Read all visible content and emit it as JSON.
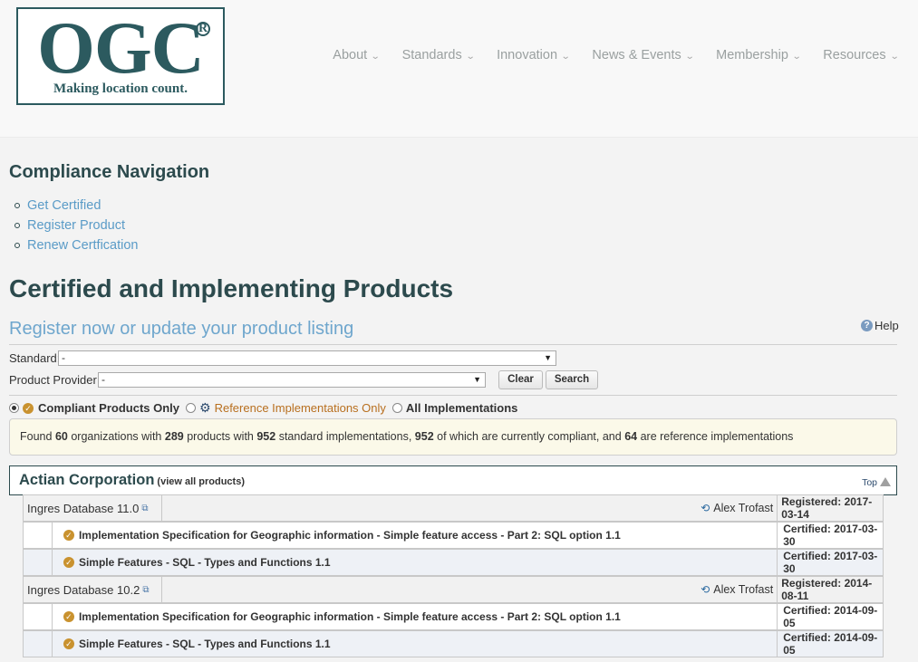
{
  "header": {
    "logo_text": "OGC",
    "logo_reg": "R",
    "logo_tagline": "Making location count.",
    "nav": [
      {
        "label": "About"
      },
      {
        "label": "Standards"
      },
      {
        "label": "Innovation"
      },
      {
        "label": "News & Events"
      },
      {
        "label": "Membership"
      },
      {
        "label": "Resources"
      }
    ]
  },
  "compliance": {
    "title": "Compliance Navigation",
    "links": [
      "Get Certified",
      "Register Product",
      "Renew Certfication"
    ]
  },
  "main": {
    "title": "Certified and Implementing Products",
    "register_link": "Register now or update your product listing",
    "help": "Help",
    "standard_label": "Standard:",
    "standard_value": "-",
    "provider_label": "Product Provider:",
    "provider_value": "-",
    "clear_label": "Clear",
    "search_label": "Search",
    "filters": {
      "compliant": "Compliant Products Only",
      "reference": "Reference Implementations Only",
      "all": "All Implementations"
    },
    "found": {
      "prefix": "Found",
      "orgs": "60",
      "t1": "organizations with",
      "products": "289",
      "t2": "products with",
      "impls": "952",
      "t3": "standard implementations,",
      "compliant": "952",
      "t4": "of which are currently compliant, and",
      "refs": "64",
      "t5": "are reference implementations"
    }
  },
  "organization": {
    "name": "Actian Corporation",
    "view_all": "(view all products)",
    "top_label": "Top",
    "products": [
      {
        "name": "Ingres Database 11.0",
        "user": "Alex Trofast",
        "registered": "Registered: 2017-03-14",
        "standards": [
          {
            "name": "Implementation Specification for Geographic information - Simple feature access - Part 2: SQL option 1.1",
            "certified": "Certified: 2017-03-30"
          },
          {
            "name": "Simple Features - SQL - Types and Functions 1.1",
            "certified": "Certified: 2017-03-30"
          }
        ]
      },
      {
        "name": "Ingres Database 10.2",
        "user": "Alex Trofast",
        "registered": "Registered: 2014-08-11",
        "standards": [
          {
            "name": "Implementation Specification for Geographic information - Simple feature access - Part 2: SQL option 1.1",
            "certified": "Certified: 2014-09-05"
          },
          {
            "name": "Simple Features - SQL - Types and Functions 1.1",
            "certified": "Certified: 2014-09-05"
          }
        ]
      }
    ]
  },
  "colors": {
    "brand": "#2c5a5f",
    "link": "#5a9bc7",
    "reference": "#b86f1f",
    "badge": "#c9922f"
  }
}
